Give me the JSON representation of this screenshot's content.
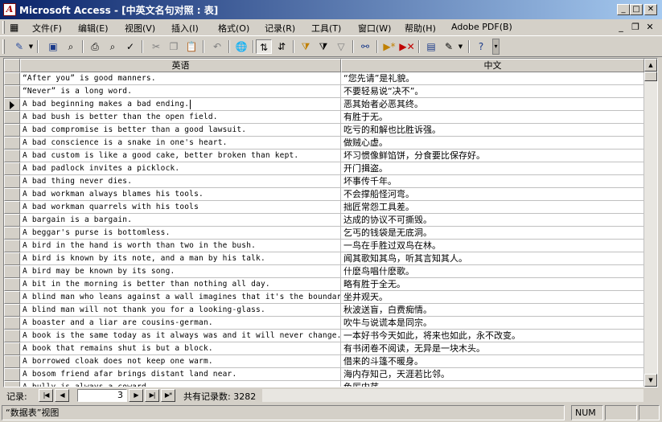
{
  "window": {
    "title": "Microsoft Access - [中英文名句对照 : 表]",
    "app_icon": "access-icon"
  },
  "menu": {
    "items": [
      "文件(F)",
      "编辑(E)",
      "视图(V)",
      "插入(I)",
      "格式(O)",
      "记录(R)",
      "工具(T)",
      "窗口(W)",
      "帮助(H)",
      "Adobe PDF(B)"
    ]
  },
  "toolbar": {
    "icons": [
      "design-view-icon",
      "save-icon",
      "search-icon",
      "print-icon",
      "print-preview-icon",
      "spelling-icon",
      "cut-icon",
      "copy-icon",
      "paste-icon",
      "undo-icon",
      "insert-hyperlink-icon",
      "sort-ascending-icon",
      "sort-descending-icon",
      "filter-by-selection-icon",
      "filter-by-form-icon",
      "apply-filter-icon",
      "find-icon",
      "new-record-icon",
      "delete-record-icon",
      "database-window-icon",
      "new-object-icon",
      "help-icon"
    ]
  },
  "table": {
    "columns": [
      "英语",
      "中文"
    ],
    "current_row": 2,
    "rows": [
      {
        "en": "“After you” is good manners.",
        "zh": "“您先请”是礼貌。"
      },
      {
        "en": "“Never” is a long word.",
        "zh": "不要轻易说“决不”。"
      },
      {
        "en": "A bad beginning makes a bad ending.",
        "zh": "恶其始者必恶其终。"
      },
      {
        "en": "A bad bush is better than the open field.",
        "zh": "有胜于无。"
      },
      {
        "en": "A bad compromise is better than a good lawsuit.",
        "zh": "吃亏的和解也比胜诉强。"
      },
      {
        "en": "A bad conscience is a snake in one's heart.",
        "zh": "做贼心虚。"
      },
      {
        "en": "A bad custom is like a good cake, better broken than kept.",
        "zh": "坏习惯像鲜馅饼，分食要比保存好。"
      },
      {
        "en": "A bad padlock invites a picklock.",
        "zh": "开门揖盗。"
      },
      {
        "en": "A bad thing never dies.",
        "zh": "坏事传千年。"
      },
      {
        "en": "A bad workman always blames his tools.",
        "zh": "不会撑船怪河弯。"
      },
      {
        "en": "A bad workman quarrels with his tools",
        "zh": "拙匠常怨工具差。"
      },
      {
        "en": "A bargain is a bargain.",
        "zh": "达成的协议不可撕毁。"
      },
      {
        "en": "A beggar's purse is bottomless.",
        "zh": "乞丐的钱袋是无底洞。"
      },
      {
        "en": "A bird in the hand is worth than two in the bush.",
        "zh": "一鸟在手胜过双鸟在林。"
      },
      {
        "en": "A bird is known by its note, and a man by his talk.",
        "zh": "闻其歌知其鸟，听其言知其人。"
      },
      {
        "en": "A bird may be known by its song.",
        "zh": "什麽鸟唱什麽歌。"
      },
      {
        "en": "A bit in the morning is better than nothing all day.",
        "zh": "略有胜于全无。"
      },
      {
        "en": "A blind man who leans against a wall imagines that it's the boundary of the world.",
        "zh": "坐井观天。"
      },
      {
        "en": "A blind man will not thank you for a looking-glass.",
        "zh": "秋波送盲，白费痴情。"
      },
      {
        "en": "A boaster and a liar are cousins-german.",
        "zh": "吹牛与说谎本是同宗。"
      },
      {
        "en": "A book is the same today as it always was and it will never change.",
        "zh": "一本好书今天如此，将来也如此，永不改变。"
      },
      {
        "en": "A book that remains shut is but a block.",
        "zh": "有书闭卷不阅读，无异是一块木头。"
      },
      {
        "en": "A borrowed cloak does not keep one warm.",
        "zh": "借来的斗篷不暖身。"
      },
      {
        "en": "A bosom friend afar brings distant land near.",
        "zh": "海内存知己，天涯若比邻。"
      },
      {
        "en": "A bully is always a coward.",
        "zh": "色厉内荏。"
      }
    ]
  },
  "navigation": {
    "label": "记录:",
    "current_record": "3",
    "total_text": "共有记录数: 3282"
  },
  "status": {
    "view": "“数据表”视图",
    "num": "NUM"
  }
}
